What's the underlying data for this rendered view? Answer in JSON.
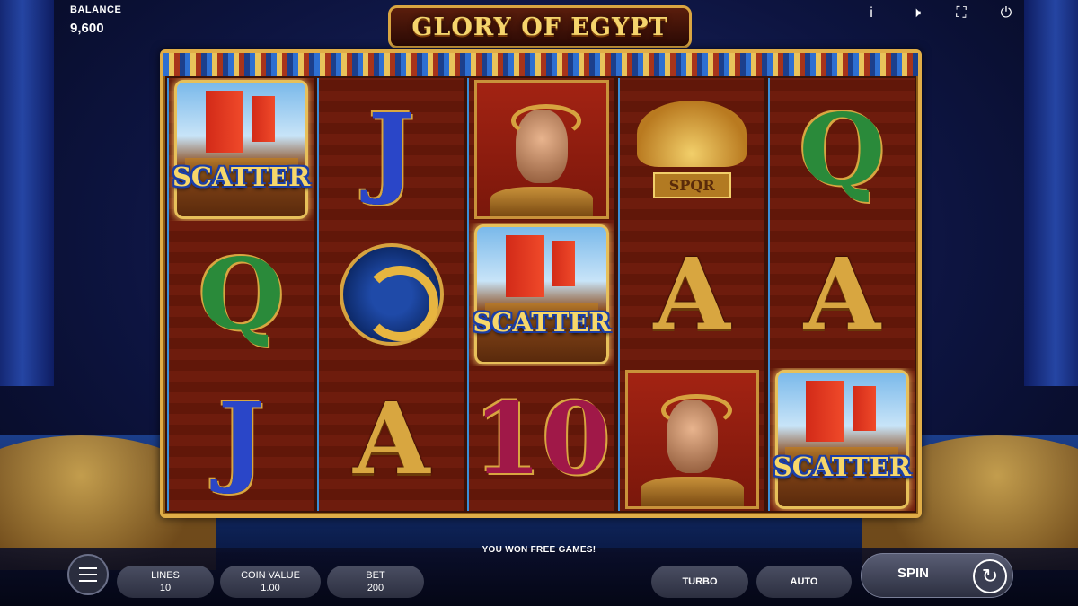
{
  "hud": {
    "balance_label": "BALANCE",
    "balance_value": "9,600",
    "icons": [
      "info-icon",
      "sound-icon",
      "fullscreen-icon",
      "power-icon"
    ]
  },
  "logo": {
    "text": "GLORY OF EGYPT"
  },
  "reels": [
    [
      {
        "symbol": "scatter",
        "label": "SCATTER"
      },
      {
        "symbol": "letter",
        "text": "Q",
        "color": "green"
      },
      {
        "symbol": "letter",
        "text": "J",
        "color": "blue"
      }
    ],
    [
      {
        "symbol": "letter",
        "text": "J",
        "color": "blue"
      },
      {
        "symbol": "snake"
      },
      {
        "symbol": "letter",
        "text": "A",
        "color": "gold"
      }
    ],
    [
      {
        "symbol": "caesar"
      },
      {
        "symbol": "scatter",
        "label": "SCATTER"
      },
      {
        "symbol": "letter",
        "text": "10",
        "color": "red"
      }
    ],
    [
      {
        "symbol": "eagle",
        "text": "SPQR"
      },
      {
        "symbol": "letter",
        "text": "A",
        "color": "gold"
      },
      {
        "symbol": "caesar"
      }
    ],
    [
      {
        "symbol": "letter",
        "text": "Q",
        "color": "green"
      },
      {
        "symbol": "letter",
        "text": "A",
        "color": "gold"
      },
      {
        "symbol": "scatter",
        "label": "SCATTER"
      }
    ]
  ],
  "status_message": "YOU WON FREE GAMES!",
  "controls": {
    "lines_label": "LINES",
    "lines_value": "10",
    "coin_value_label": "COIN VALUE",
    "coin_value_value": "1.00",
    "bet_label": "BET",
    "bet_value": "200",
    "turbo_label": "TURBO",
    "auto_label": "AUTO",
    "spin_label": "SPIN"
  },
  "colors": {
    "gold": "#d8a640",
    "frame": "#e0ad47",
    "scatter_text": "#f7d76a"
  }
}
